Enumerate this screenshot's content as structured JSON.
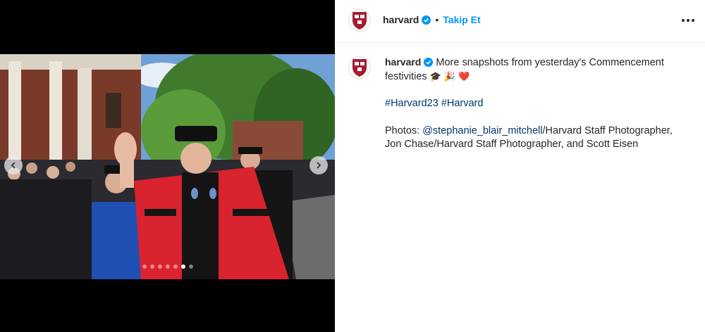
{
  "post": {
    "account": "harvard",
    "follow_label": "Takip Et",
    "separator": "•",
    "more_label": "More options"
  },
  "caption": {
    "username": "harvard",
    "text_line1": "More snapshots from yesterday's Commencement festivities",
    "emojis": [
      "🎓",
      "🎉",
      "❤️"
    ],
    "hashtags": [
      "#Harvard23",
      "#Harvard"
    ],
    "credits_prefix": "Photos: ",
    "credits_mention": "@stephanie_blair_mitchell",
    "credits_rest": "/Harvard Staff Photographer, Jon Chase/Harvard Staff Photographer, and Scott Eisen"
  },
  "carousel": {
    "slide_count": 7,
    "active_index": 5
  },
  "colors": {
    "accent_blue": "#0095f6",
    "link_blue": "#00376b",
    "harvard_crimson": "#a51c30",
    "text": "#262626"
  },
  "icons": {
    "prev": "chevron-left-icon",
    "next": "chevron-right-icon",
    "more": "ellipsis-icon",
    "verified": "verified-badge-icon"
  }
}
